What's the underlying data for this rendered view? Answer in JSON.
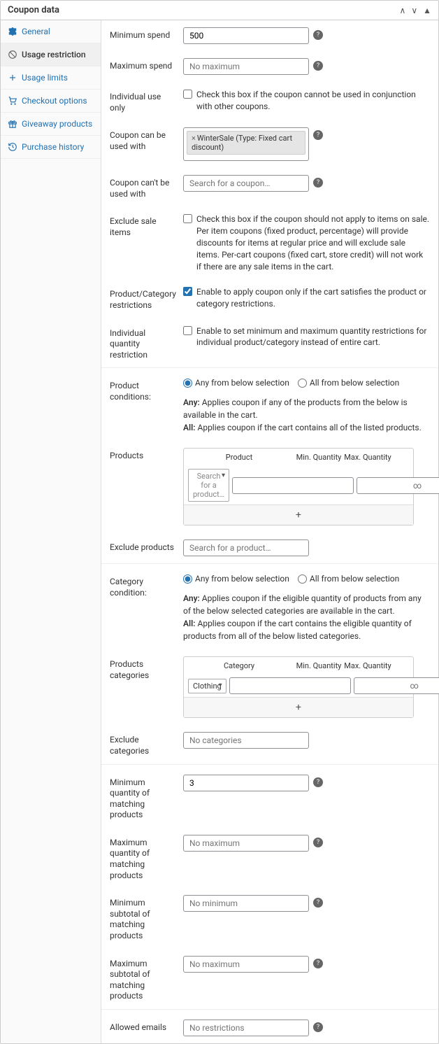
{
  "header": {
    "title": "Coupon data"
  },
  "sidebar": {
    "items": [
      {
        "label": "General"
      },
      {
        "label": "Usage restriction"
      },
      {
        "label": "Usage limits"
      },
      {
        "label": "Checkout options"
      },
      {
        "label": "Giveaway products"
      },
      {
        "label": "Purchase history"
      }
    ]
  },
  "form": {
    "min_spend": {
      "label": "Minimum spend",
      "value": "500"
    },
    "max_spend": {
      "label": "Maximum spend",
      "placeholder": "No maximum"
    },
    "individual_use": {
      "label": "Individual use only",
      "text": "Check this box if the coupon cannot be used in conjunction with other coupons."
    },
    "used_with": {
      "label": "Coupon can be used with",
      "tag": "WinterSale (Type: Fixed cart discount)"
    },
    "cant_used_with": {
      "label": "Coupon can't be used with",
      "placeholder": "Search for a coupon…"
    },
    "exclude_sale": {
      "label": "Exclude sale items",
      "text": "Check this box if the coupon should not apply to items on sale. Per item coupons (fixed product, percentage) will provide discounts for items at regular price and will exclude sale items. Per-cart coupons (fixed cart, store credit) will not work if there are any sale items in the cart."
    },
    "prod_cat_restrict": {
      "label": "Product/Category restrictions",
      "text": "Enable to apply coupon only if the cart satisfies the product or category restrictions."
    },
    "indiv_qty": {
      "label": "Individual quantity restriction",
      "text": "Enable to set minimum and maximum quantity restrictions for individual product/category instead of entire cart."
    },
    "prod_cond": {
      "label": "Product conditions:",
      "opt1": "Any from below selection",
      "opt2": "All from below selection",
      "desc_any_label": "Any:",
      "desc_any": "Applies coupon if any of the products from the below is available in the cart.",
      "desc_all_label": "All:",
      "desc_all": "Applies coupon if the cart contains all of the listed products."
    },
    "products": {
      "label": "Products",
      "col_prod": "Product",
      "col_min": "Min. Quantity",
      "col_max": "Max. Quantity",
      "placeholder": "Search for a product…",
      "inf": "∞",
      "add": "+"
    },
    "exclude_products": {
      "label": "Exclude products",
      "placeholder": "Search for a product…"
    },
    "cat_cond": {
      "label": "Category condition:",
      "opt1": "Any from below selection",
      "opt2": "All from below selection",
      "desc_any_label": "Any:",
      "desc_any": "Applies coupon if the eligible quantity of products from any of the below selected categories are available in the cart.",
      "desc_all_label": "All:",
      "desc_all": "Applies coupon if the cart contains the eligible quantity of products from all of the below listed categories."
    },
    "prod_categories": {
      "label": "Products categories",
      "col_cat": "Category",
      "col_min": "Min. Quantity",
      "col_max": "Max. Quantity",
      "value": "Clothing",
      "inf": "∞",
      "add": "+"
    },
    "exclude_categories": {
      "label": "Exclude categories",
      "placeholder": "No categories"
    },
    "min_qty": {
      "label": "Minimum quantity of matching products",
      "value": "3"
    },
    "max_qty": {
      "label": "Maximum quantity of matching products",
      "placeholder": "No maximum"
    },
    "min_subtotal": {
      "label": "Minimum subtotal of matching products",
      "placeholder": "No minimum"
    },
    "max_subtotal": {
      "label": "Maximum subtotal of matching products",
      "placeholder": "No maximum"
    },
    "allowed_emails": {
      "label": "Allowed emails",
      "placeholder": "No restrictions"
    }
  }
}
